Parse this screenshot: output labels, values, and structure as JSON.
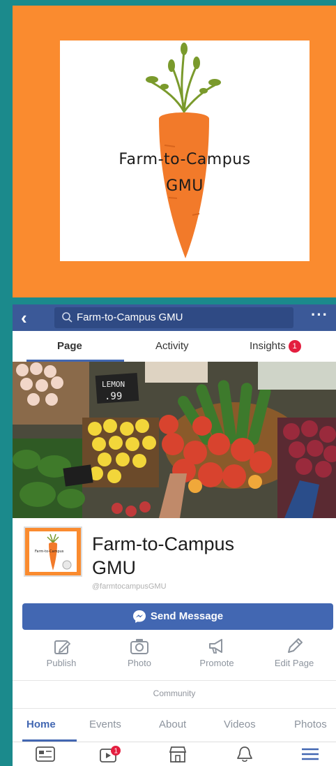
{
  "logo": {
    "line1": "Farm-to-Campus",
    "line2": "GMU",
    "colors": {
      "panel": "#fa8b2f",
      "carrot": "#f27a2a",
      "leaves": "#7a9a2c"
    }
  },
  "header": {
    "back_icon": "back-arrow-icon",
    "search_icon": "search-icon",
    "search_text": "Farm-to-Campus GMU",
    "more_label": "···",
    "color": "#3b5998"
  },
  "tabs": [
    {
      "label": "Page",
      "active": true
    },
    {
      "label": "Activity",
      "active": false
    },
    {
      "label": "Insights",
      "active": false,
      "badge": "1"
    }
  ],
  "profile": {
    "name_line1": "Farm-to-Campus",
    "name_line2": "GMU",
    "handle": "@farmtocampusGMU"
  },
  "send_message": {
    "label": "Send Message",
    "icon": "messenger-icon"
  },
  "actions": [
    {
      "label": "Publish",
      "icon": "edit-square-icon"
    },
    {
      "label": "Photo",
      "icon": "camera-icon"
    },
    {
      "label": "Promote",
      "icon": "megaphone-icon"
    },
    {
      "label": "Edit Page",
      "icon": "pencil-icon"
    }
  ],
  "community_label": "Community",
  "sub_tabs": [
    {
      "label": "Home",
      "active": true
    },
    {
      "label": "Events"
    },
    {
      "label": "About"
    },
    {
      "label": "Videos"
    },
    {
      "label": "Photos"
    }
  ],
  "bottom_nav": [
    {
      "icon": "news-feed-icon"
    },
    {
      "icon": "video-icon",
      "badge": "1"
    },
    {
      "icon": "marketplace-icon"
    },
    {
      "icon": "bell-icon"
    },
    {
      "icon": "menu-icon"
    }
  ],
  "cover": {
    "sign_text": "LEMON\n.99"
  }
}
